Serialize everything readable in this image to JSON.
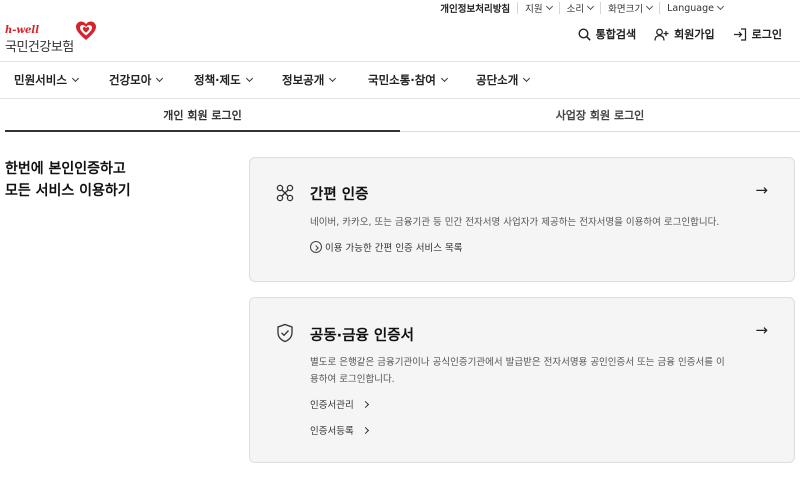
{
  "utility_bar": {
    "privacy": "개인정보처리방침",
    "support": "지원",
    "sound": "소리",
    "screen_size": "화면크기",
    "language": "Language"
  },
  "logo": {
    "brand": "h-well",
    "org_name": "국민건강보험"
  },
  "header": {
    "search": "통합검색",
    "signup": "회원가입",
    "login": "로그인"
  },
  "nav": {
    "items": [
      {
        "label": "민원서비스"
      },
      {
        "label": "건강모아"
      },
      {
        "label": "정책·제도"
      },
      {
        "label": "정보공개"
      },
      {
        "label": "국민소통·참여"
      },
      {
        "label": "공단소개"
      }
    ]
  },
  "tabs": {
    "personal": "개인 회원 로그인",
    "business": "사업장 회원 로그인",
    "active": "personal"
  },
  "lead": {
    "line1": "한번에 본인인증하고",
    "line2": "모든 서비스 이용하기"
  },
  "simple_auth": {
    "title": "간편 인증",
    "arrow": "→",
    "description": "네이버, 카카오, 또는 금융기관 등 민간 전자서명 사업자가 제공하는 전자서명을 이용하여 로그인합니다.",
    "list_link": "이용 가능한 간편 인증 서비스 목록"
  },
  "cert_auth": {
    "title": "공동·금융 인증서",
    "arrow": "→",
    "description_line1": "별도로 은행같은 금융기관이나 공식인증기관에서 발급받은 전자서명용 공인인증서 또는 금융 인증서를 이",
    "description_line2": "용하여 로그인합니다.",
    "manage_link": "인증서관리",
    "register_link": "인증서등록"
  },
  "colors": {
    "brand_red": "#d8222a",
    "card_bg": "#f5f5f5",
    "text_dark": "#111111"
  }
}
